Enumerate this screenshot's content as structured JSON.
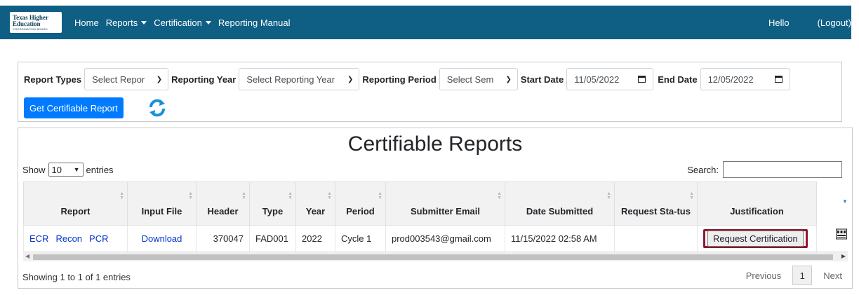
{
  "navbar": {
    "logo_line1": "Texas Higher",
    "logo_line2": "Education",
    "logo_line3": "COORDINATING BOARD",
    "items": [
      {
        "label": "Home",
        "dropdown": false
      },
      {
        "label": "Reports",
        "dropdown": true
      },
      {
        "label": "Certification",
        "dropdown": true
      },
      {
        "label": "Reporting Manual",
        "dropdown": false
      }
    ],
    "hello": "Hello",
    "logout": "(Logout)",
    "bg_color": "#0f5f85"
  },
  "filters": {
    "report_types_label": "Report Types",
    "report_types_value": "Select Repor",
    "reporting_year_label": "Reporting Year",
    "reporting_year_value": "Select Reporting Year",
    "reporting_period_label": "Reporting Period",
    "reporting_period_value": "Select Sem",
    "start_date_label": "Start Date",
    "start_date_value": "11/05/2022",
    "end_date_label": "End Date",
    "end_date_value": "12/05/2022",
    "get_button": "Get Certifiable Report",
    "refresh_icon": "refresh-icon"
  },
  "main": {
    "title": "Certifiable Reports",
    "show_label": "Show",
    "entries_value": "10",
    "entries_label": "entries",
    "search_label": "Search:",
    "columns": [
      "Report",
      "Input File",
      "Header",
      "Type",
      "Year",
      "Period",
      "Submitter Email",
      "Date Submitted",
      "Request Sta-tus",
      "Justification"
    ],
    "rows": [
      {
        "report_links": [
          "ECR",
          "Recon",
          "PCR"
        ],
        "input_file": "Download",
        "header": "370047",
        "type": "FAD001",
        "year": "2022",
        "period": "Cycle 1",
        "email": "prod003543@gmail.com",
        "date_submitted": "11/15/2022 02:58 AM",
        "request_status": "",
        "action": "Request Certification"
      }
    ],
    "info": "Showing 1 to 1 of 1 entries",
    "pager": {
      "previous": "Previous",
      "page": "1",
      "next": "Next"
    },
    "highlight_color": "#8b1a2d",
    "link_color": "#0033cc"
  }
}
